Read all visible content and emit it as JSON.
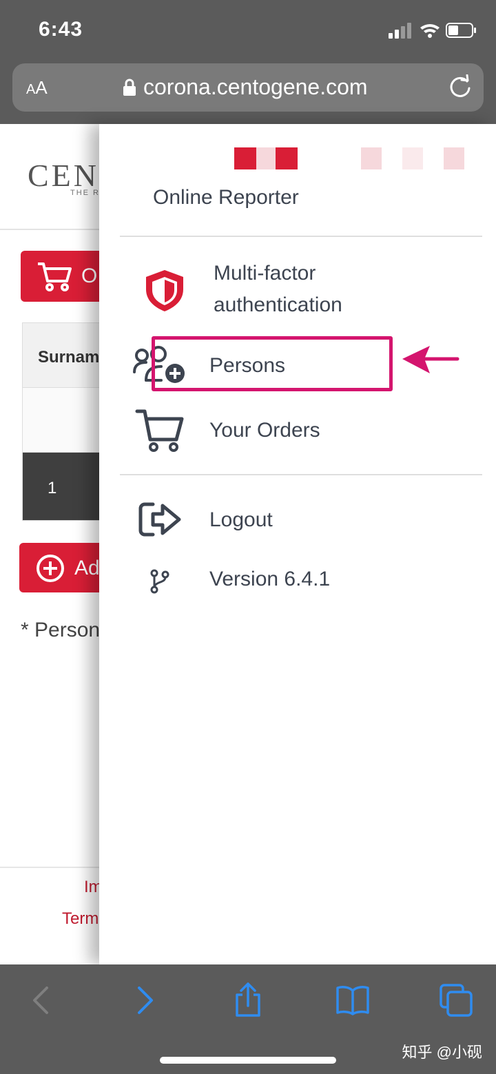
{
  "status_bar": {
    "time": "6:43"
  },
  "browser": {
    "text_size_label_small": "A",
    "text_size_label_large": "A",
    "url": "corona.centogene.com"
  },
  "background_page": {
    "logo": "CEN",
    "logo_sub": "THE R",
    "order_button_label": "O",
    "table_header": "Surnam",
    "row_number": "1",
    "add_button_label": "Ad",
    "note": "* Person",
    "footer_link_1": "Im",
    "footer_link_2": "Term"
  },
  "drawer": {
    "title": "Online Reporter",
    "menu": [
      {
        "label": "Multi-factor\nauthentication",
        "icon": "shield-icon"
      },
      {
        "label": "Persons",
        "icon": "add-user-icon"
      },
      {
        "label": "Your Orders",
        "icon": "cart-icon"
      }
    ],
    "logout_label": "Logout",
    "version_label": "Version 6.4.1"
  },
  "watermark": "知乎 @小砚",
  "colors": {
    "brand_red": "#d91e36",
    "annotation_magenta": "#d4156e",
    "text_dark": "#3d4450",
    "browser_chrome": "#5b5b5b"
  }
}
